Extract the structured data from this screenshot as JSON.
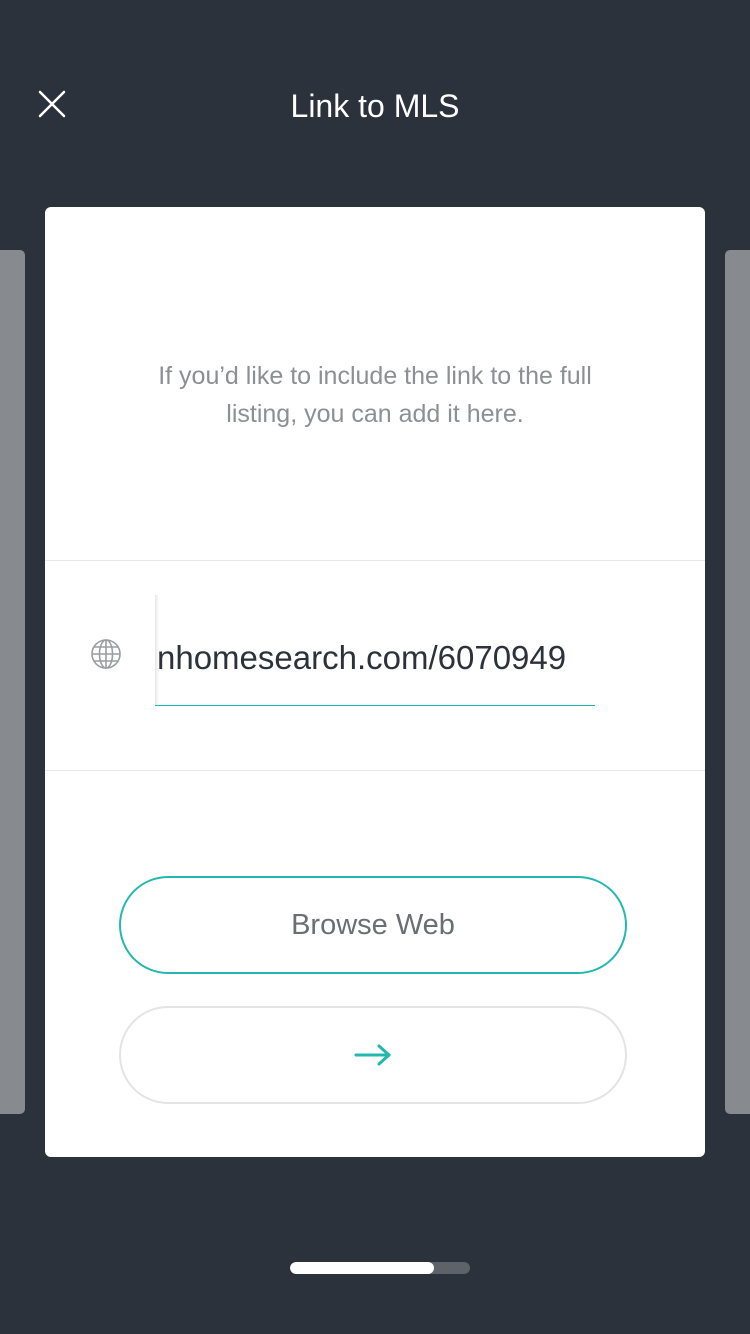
{
  "header": {
    "title": "Link to MLS",
    "close_icon": "close-icon"
  },
  "card": {
    "description": "If you’d like to include the link to the full listing, you can add it here.",
    "url_field": {
      "icon": "globe-icon",
      "value": "nhomesearch.com/6070949"
    },
    "browse_button_label": "Browse Web",
    "next_button_icon": "arrow-right-icon"
  },
  "progress": {
    "fraction": 0.8
  },
  "colors": {
    "background": "#2c323b",
    "accent": "#23b8af",
    "card": "#ffffff",
    "muted_text": "#8c8f93"
  }
}
